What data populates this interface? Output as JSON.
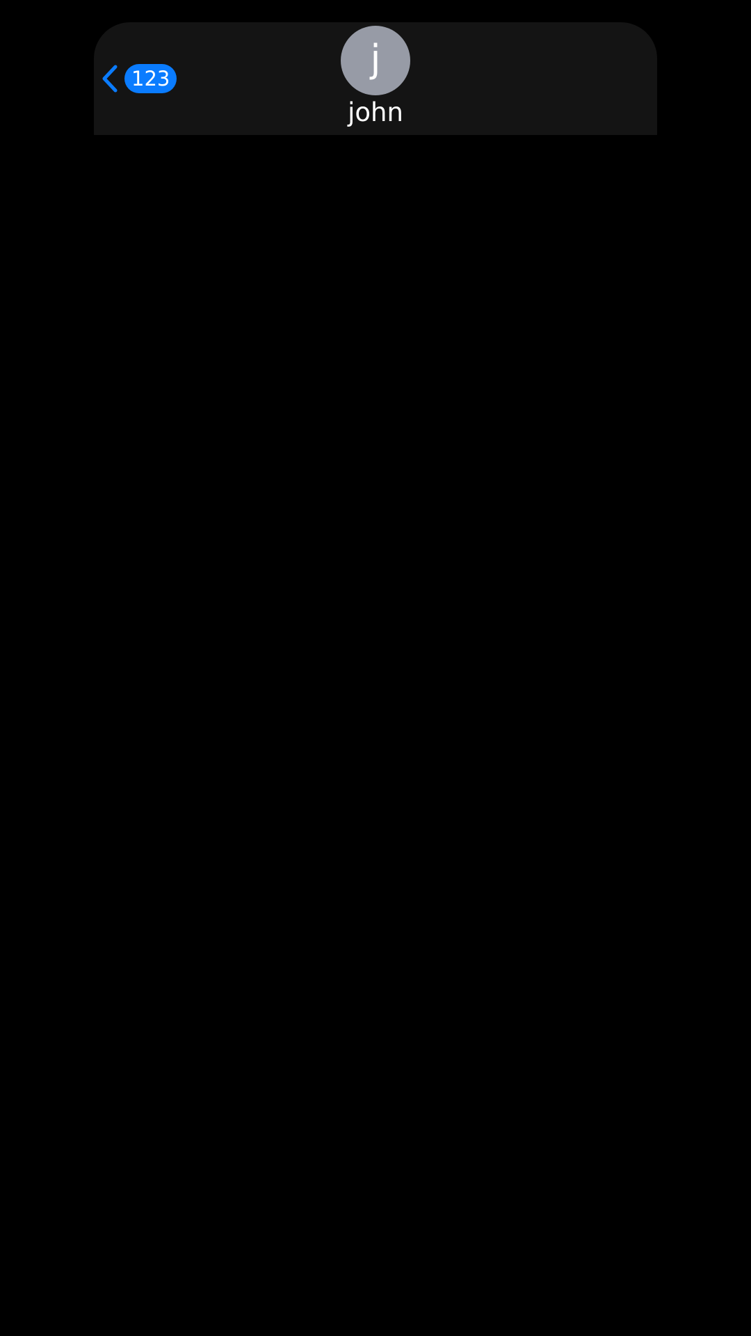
{
  "header": {
    "back_badge": "123",
    "avatar_initial": "j",
    "contact_name": "john"
  },
  "icons": {
    "back": "chevron-left-icon"
  },
  "colors": {
    "background": "#000000",
    "header_background": "#141414",
    "accent": "#0a7cff",
    "avatar": "#979ba6",
    "text": "#ffffff"
  }
}
